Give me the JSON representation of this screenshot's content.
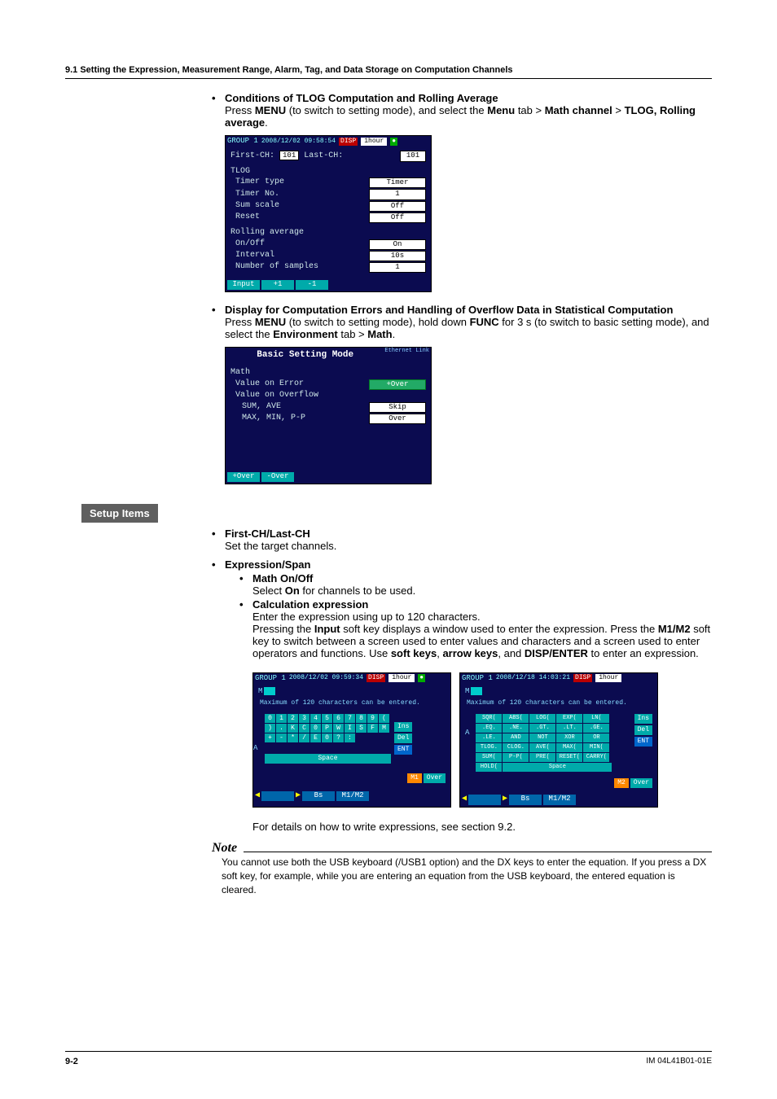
{
  "header": "9.1  Setting the Expression, Measurement Range, Alarm, Tag, and Data Storage on Computation Channels",
  "s1": {
    "title": "Conditions of TLOG Computation and Rolling Average",
    "p_pre": "Press ",
    "p_menu": "MENU",
    "p_mid": " (to switch to setting mode), and select the ",
    "p_menutab": "Menu",
    "p_gt1": " tab > ",
    "p_math": "Math channel",
    "p_gt2": " > ",
    "p_last": "TLOG, Rolling average",
    "p_end": "."
  },
  "dev_tlog": {
    "group": "GROUP 1",
    "time": "2008/12/02 09:58:54",
    "disp": "DISP",
    "interval": "1hour",
    "first_lbl": "First-CH:",
    "first_val": "101",
    "last_lbl": "Last-CH:",
    "last_val": "101",
    "h_tlog": "TLOG",
    "tt_lbl": "Timer type",
    "tt_val": "Timer",
    "tn_lbl": "Timer No.",
    "tn_val": "1",
    "ss_lbl": "Sum scale",
    "ss_val": "Off",
    "rs_lbl": "Reset",
    "rs_val": "Off",
    "h_roll": "Rolling average",
    "oo_lbl": "On/Off",
    "oo_val": "On",
    "iv_lbl": "Interval",
    "iv_val": "10s",
    "ns_lbl": "Number of samples",
    "ns_val": "1",
    "sk1": "Input",
    "sk2": "+1",
    "sk3": "-1"
  },
  "s2": {
    "title": "Display for Computation Errors and Handling of Overflow Data in Statistical Computation",
    "p_pre": "Press ",
    "p_menu": "MENU",
    "p_mid1": " (to switch to setting mode), hold down ",
    "p_func": "FUNC",
    "p_mid2": " for 3 s (to switch to basic setting mode), and select the ",
    "p_env": "Environment",
    "p_tab": " tab > ",
    "p_math": "Math",
    "p_end": "."
  },
  "dev_basic": {
    "title": "Basic Setting Mode",
    "eth": "Ethernet Link",
    "h_math": "Math",
    "voe_lbl": "Value on Error",
    "voe_val": "+Over",
    "voo_lbl": "Value on Overflow",
    "sa_lbl": "SUM, AVE",
    "sa_val": "Skip",
    "mm_lbl": "MAX, MIN, P-P",
    "mm_val": "Over",
    "sk1": "+Over",
    "sk2": "-Over"
  },
  "setup_label": "Setup Items",
  "si1": {
    "title": "First-CH/Last-CH",
    "body": "Set the target channels."
  },
  "si2": {
    "title": "Expression/Span",
    "sub1_t": "Math On/Off",
    "sub1_b_pre": "Select ",
    "sub1_b_on": "On",
    "sub1_b_post": " for channels to be used.",
    "sub2_t": "Calculation expression",
    "sub2_b1": "Enter the expression using up to 120 characters.",
    "sub2_b2a": "Pressing the ",
    "sub2_b2b": "Input",
    "sub2_b2c": " soft key displays a window used to enter the expression. Press the ",
    "sub2_b2d": "M1/M2",
    "sub2_b2e": " soft key to switch between a screen used to enter values and characters and a screen used to enter operators and functions. Use ",
    "sub2_b2f": "soft keys",
    "sub2_b2g": ", ",
    "sub2_b2h": "arrow keys",
    "sub2_b2i": ", and ",
    "sub2_b2j": "DISP/ENTER",
    "sub2_b2k": " to enter an expression."
  },
  "dev_exprL": {
    "group": "GROUP 1",
    "time": "2008/12/02 09:59:34",
    "disp": "DISP",
    "interval": "1hour",
    "hint": "Maximum of 120 characters can be entered.",
    "m": "M",
    "a": "A",
    "ins": "Ins",
    "del": "Del",
    "ent": "ENT",
    "space": "Space",
    "m1": "M1",
    "over": "Over",
    "bs": "Bs",
    "m1m2": "M1/M2",
    "keys": [
      "0",
      "1",
      "2",
      "3",
      "4",
      "5",
      "6",
      "7",
      "8",
      "9",
      "(",
      ")",
      ".",
      "K",
      "C",
      "0",
      "P",
      "W",
      "I",
      "S",
      "F",
      "M",
      "+",
      "-",
      "*",
      "/",
      "E",
      "0",
      "?",
      ":"
    ]
  },
  "dev_exprR": {
    "group": "GROUP 1",
    "time": "2008/12/18 14:03:21",
    "disp": "DISP",
    "interval": "1hour",
    "hint": "Maximum of 120 characters can be entered.",
    "m": "M",
    "a": "A",
    "ins": "Ins",
    "del": "Del",
    "ent": "ENT",
    "space": "Space",
    "m2": "M2",
    "over": "Over",
    "bs": "Bs",
    "m1m2": "M1/M2",
    "funcs": [
      "SQR(",
      "ABS(",
      "LOG(",
      "EXP(",
      "LN(",
      ".EQ.",
      ".NE.",
      ".GT.",
      ".LT.",
      ".GE.",
      ".LE.",
      "AND",
      "NOT",
      "XOR",
      "OR",
      "TLOG.",
      "CLOG.",
      "AVE(",
      "MAX(",
      "MIN(",
      "SUM(",
      "P-P(",
      "PRE(",
      "RESET(",
      "CARRY(",
      "HOLD("
    ]
  },
  "post_expr": "For details on how to write expressions, see section 9.2.",
  "note_title": "Note",
  "note_body": "You cannot use both the USB keyboard (/USB1 option) and the DX keys to enter the equation. If you press a DX soft key, for example, while you are entering an equation from the USB keyboard, the entered equation is cleared.",
  "footer_left": "9-2",
  "footer_right": "IM 04L41B01-01E"
}
